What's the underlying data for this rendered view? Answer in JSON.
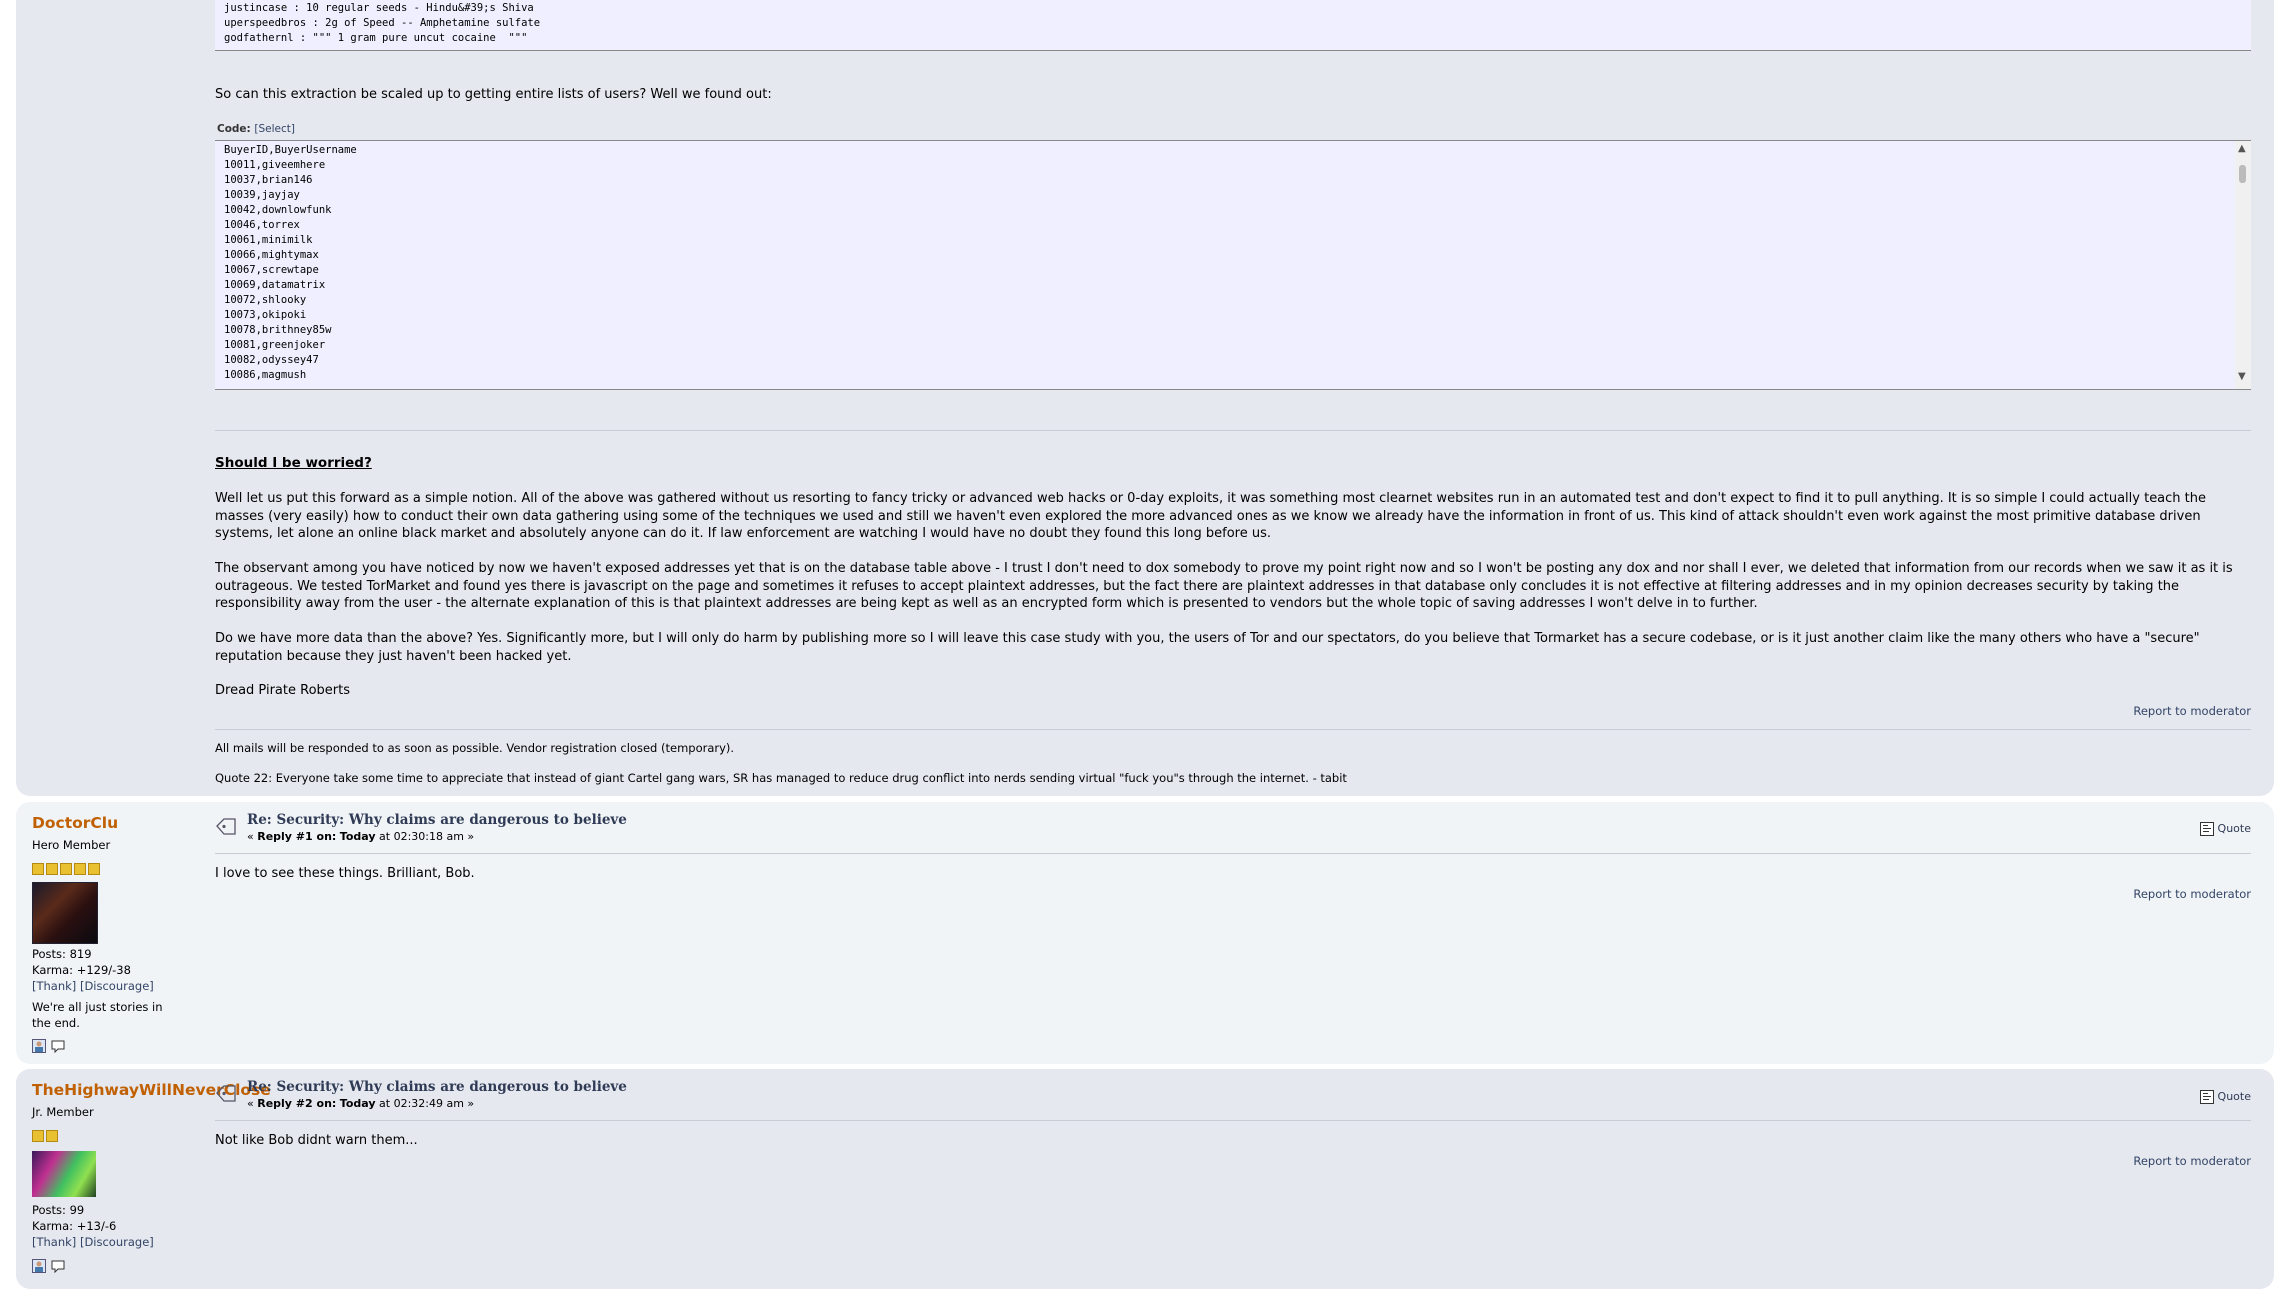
{
  "top_code_lines": [
    "justincase : 10 regular seeds - Hindu&#39;s Shiva",
    "uperspeedbros : 2g of Speed -- Amphetamine sulfate",
    "godfathernl : \"\"\" 1 gram pure uncut cocaine  \"\"\""
  ],
  "post1": {
    "intro_text": "So can this extraction be scaled up to getting entire lists of users? Well we found out:",
    "code_label": "Code:",
    "code_select": "[Select]",
    "code_lines": [
      "BuyerID,BuyerUsername",
      "10011,giveemhere",
      "10037,brian146",
      "10039,jayjay",
      "10042,downlowfunk",
      "10046,torrex",
      "10061,minimilk",
      "10066,mightymax",
      "10067,screwtape",
      "10069,datamatrix",
      "10072,shlooky",
      "10073,okipoki",
      "10078,brithney85w",
      "10081,greenjoker",
      "10082,odyssey47",
      "10086,magmush"
    ],
    "heading": "Should I be worried?",
    "para1": "Well let us put this forward as a simple notion. All of the above was gathered without us resorting to fancy tricky or advanced web hacks or 0-day exploits, it was something most clearnet websites run in an automated test and don't expect to find it to pull anything. It is so simple I could actually teach the masses (very easily) how to conduct their own data gathering using some of the techniques we used and still we haven't even explored the more advanced ones as we know we already have the information in front of us. This kind of attack shouldn't even work against the most primitive database driven systems, let alone an online black market and absolutely anyone can do it. If law enforcement are watching I would have no doubt they found this long before us.",
    "para2": "The observant among you have noticed by now we haven't exposed addresses yet that is on the database table above - I trust I don't need to dox somebody to prove my point right now and so I won't be posting any dox and nor shall I ever, we deleted that information from our records when we saw it as it is outrageous. We tested TorMarket and found yes there is javascript on the page and sometimes it refuses to accept plaintext addresses, but the fact there are plaintext addresses in that database only concludes it is not effective at filtering addresses and in my opinion decreases security by taking the responsibility away from the user - the alternate explanation of this is that plaintext addresses are being kept as well as an encrypted form which is presented to vendors but the whole topic of saving addresses I won't delve in to further.",
    "para3": "Do we have more data than the above? Yes. Significantly more, but I will only do harm by publishing more so I will leave this case study with you, the users of Tor and our spectators, do you believe that Tormarket has a secure codebase, or is it just another claim like the many others who have a \"secure\" reputation because they just haven't been hacked yet.",
    "sign": "Dread Pirate Roberts",
    "report": "Report to moderator",
    "sig1": "All mails will be responded to as soon as possible. Vendor registration closed (temporary).",
    "sig2": "Quote 22: Everyone take some time to appreciate that instead of giant Cartel gang wars, SR has managed to reduce drug conflict into nerds sending virtual \"fuck you\"s through the internet. - tabit"
  },
  "post2": {
    "name": "DoctorClu",
    "rank": "Hero Member",
    "stars": 5,
    "posts": "Posts: 819",
    "karma": "Karma: +129/-38",
    "thank": "[Thank]",
    "discourage": "[Discourage]",
    "personal": "We're all just stories in the end.",
    "subject": "Re: Security: Why claims are dangerous to believe",
    "reply_prefix": "« ",
    "reply_num": "Reply #1 on:",
    "reply_today": "Today",
    "reply_time": " at 02:30:18 am »",
    "quote": "Quote",
    "body": "I love to see these things. Brilliant, Bob.",
    "report": "Report to moderator"
  },
  "post3": {
    "name": "TheHighwayWillNeverClose",
    "rank": "Jr. Member",
    "stars": 2,
    "posts": "Posts: 99",
    "karma": "Karma: +13/-6",
    "thank": "[Thank]",
    "discourage": "[Discourage]",
    "subject": "Re: Security: Why claims are dangerous to believe",
    "reply_prefix": "« ",
    "reply_num": "Reply #2 on:",
    "reply_today": "Today",
    "reply_time": " at 02:32:49 am »",
    "quote": "Quote",
    "body": "Not like Bob didnt warn them...",
    "report": "Report to moderator"
  },
  "icons": {
    "topic": "topic-icon",
    "quote": "quote-icon",
    "profile": "profile-icon",
    "message": "message-icon",
    "scroll_up": "scroll-up-arrow-icon",
    "scroll_down": "scroll-down-arrow-icon"
  },
  "colors": {
    "poster_name": "#c06002",
    "link": "#334466",
    "code_bg": "#efefff"
  }
}
